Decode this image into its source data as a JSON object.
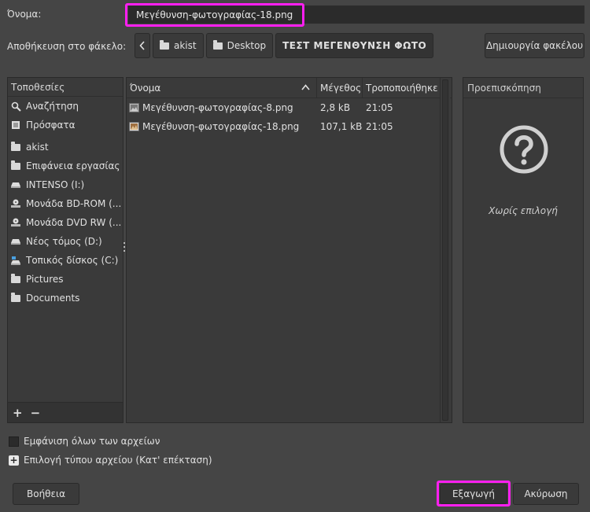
{
  "name_row": {
    "label": "Όνομα:",
    "filename": "Μεγέθυνση-φωτογραφίας-18.png"
  },
  "folder_row": {
    "label": "Αποθήκευση στο φάκελο:",
    "breadcrumbs": [
      "akist",
      "Desktop",
      "ΤΕΣΤ ΜΕΓΕΝΘΥΝΣΗ ΦΩΤΟ"
    ],
    "create_folder": "Δημιουργία φακέλου"
  },
  "places": {
    "header": "Τοποθεσίες",
    "group1": [
      {
        "label": "Αναζήτηση",
        "icon": "search-icon"
      },
      {
        "label": "Πρόσφατα",
        "icon": "recent-icon"
      }
    ],
    "group2": [
      {
        "label": "akist",
        "icon": "folder-icon"
      },
      {
        "label": "Επιφάνεια εργασίας",
        "icon": "folder-icon"
      },
      {
        "label": "INTENSO (I:)",
        "icon": "drive-icon"
      },
      {
        "label": "Μονάδα BD-ROM (...",
        "icon": "optical-drive-icon"
      },
      {
        "label": "Μονάδα DVD RW (...",
        "icon": "optical-drive-icon"
      },
      {
        "label": "Νέος τόμος (D:)",
        "icon": "drive-icon"
      },
      {
        "label": "Τοπικός δίσκος (C:)",
        "icon": "system-drive-icon"
      },
      {
        "label": "Pictures",
        "icon": "folder-icon"
      },
      {
        "label": "Documents",
        "icon": "folder-icon"
      }
    ],
    "add": "+",
    "remove": "−"
  },
  "files": {
    "columns": {
      "name": "Όνομα",
      "size": "Μέγεθος",
      "modified": "Τροποποιήθηκε"
    },
    "rows": [
      {
        "name": "Μεγέθυνση-φωτογραφίας-8.png",
        "size": "2,8 kB",
        "modified": "21:05"
      },
      {
        "name": "Μεγέθυνση-φωτογραφίας-18.png",
        "size": "107,1 kB",
        "modified": "21:05"
      }
    ]
  },
  "preview": {
    "header": "Προεπισκόπηση",
    "no_selection": "Χωρίς επιλογή"
  },
  "options": {
    "show_all": "Εμφάνιση όλων των αρχείων",
    "file_type": "Επιλογή τύπου αρχείου (Κατ' επέκταση)",
    "expander": "+"
  },
  "buttons": {
    "help": "Βοήθεια",
    "export": "Εξαγωγή",
    "cancel": "Ακύρωση"
  },
  "colors": {
    "highlight": "#ff1ff0",
    "background": "#454545"
  }
}
